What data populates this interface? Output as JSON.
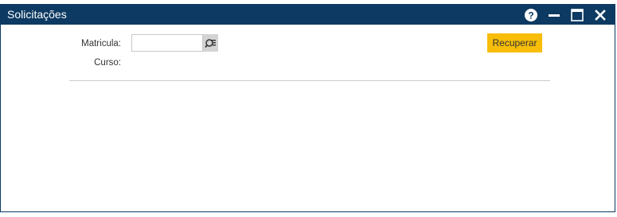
{
  "window": {
    "title": "Solicitações"
  },
  "titlebar_icons": {
    "help": "help-icon",
    "minimize": "minimize-icon",
    "maximize": "maximize-icon",
    "close": "close-icon"
  },
  "form": {
    "matricula_label": "Matricula:",
    "matricula_value": "",
    "curso_label": "Curso:",
    "lookup_icon": "search-list-icon"
  },
  "actions": {
    "recuperar_label": "Recuperar"
  },
  "colors": {
    "titlebar": "#0d3a62",
    "accent_button": "#f7bd08"
  }
}
